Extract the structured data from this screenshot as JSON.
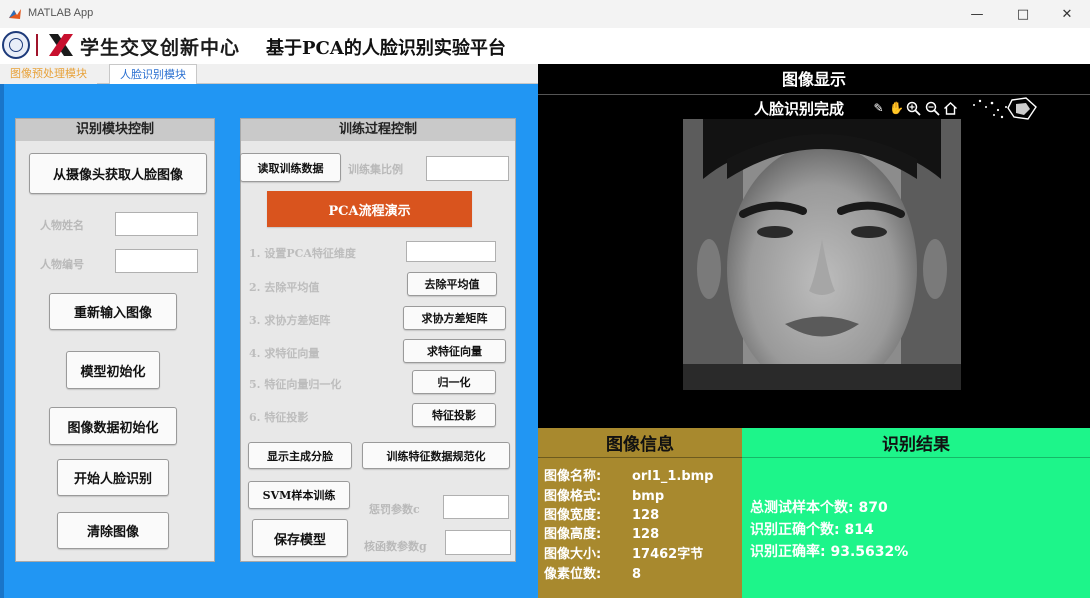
{
  "window": {
    "title": "MATLAB App"
  },
  "header": {
    "logo_text": "学生交叉创新中心",
    "platform_title": "基于PCA的人脸识别实验平台"
  },
  "tabs": [
    {
      "label": "图像预处理模块",
      "active": false
    },
    {
      "label": "人脸识别模块",
      "active": true
    }
  ],
  "recognition_control": {
    "title": "识别模块控制",
    "capture_button": "从摄像头获取人脸图像",
    "name_label": "人物姓名",
    "id_label": "人物编号",
    "reinput_button": "重新输入图像",
    "model_init_button": "模型初始化",
    "image_data_init_button": "图像数据初始化",
    "start_recognition_button": "开始人脸识别",
    "clear_button": "清除图像"
  },
  "training_control": {
    "title": "训练过程控制",
    "read_data_button": "读取训练数据",
    "train_ratio_label": "训练集比例",
    "pca_demo_button": "PCA流程演示",
    "steps": [
      {
        "label": "1. 设置PCA特征维度",
        "button": ""
      },
      {
        "label": "2. 去除平均值",
        "button": "去除平均值"
      },
      {
        "label": "3. 求协方差矩阵",
        "button": "求协方差矩阵"
      },
      {
        "label": "4. 求特征向量",
        "button": "求特征向量"
      },
      {
        "label": "5. 特征向量归一化",
        "button": "归一化"
      },
      {
        "label": "6. 特征投影",
        "button": "特征投影"
      }
    ],
    "show_components_button": "显示主成分脸",
    "normalize_features_button": "训练特征数据规范化",
    "svm_train_button": "SVM样本训练",
    "penalty_label": "惩罚参数c",
    "save_model_button": "保存模型",
    "kernel_label": "核函数参数g"
  },
  "display": {
    "title": "图像显示",
    "status": "人脸识别完成",
    "tools": [
      "edit-icon",
      "pan-hand-icon",
      "zoom-in-icon",
      "zoom-out-icon",
      "home-icon"
    ]
  },
  "image_info": {
    "title": "图像信息",
    "rows": [
      {
        "key": "图像名称:",
        "value": "orl1_1.bmp"
      },
      {
        "key": "图像格式:",
        "value": "bmp"
      },
      {
        "key": "图像宽度:",
        "value": "128"
      },
      {
        "key": "图像高度:",
        "value": "128"
      },
      {
        "key": "图像大小:",
        "value": "17462字节"
      },
      {
        "key": "像素位数:",
        "value": "8"
      }
    ]
  },
  "recognition_result": {
    "title": "识别结果",
    "rows": [
      "总测试样本个数: 870",
      "识别正确个数: 814",
      "识别正确率: 93.5632%"
    ]
  },
  "colors": {
    "left_panel_bg": "#2196f3",
    "pca_button": "#d9541e",
    "info_bg": "#a8892e",
    "result_bg": "#1df58a",
    "display_bg": "#000000"
  }
}
